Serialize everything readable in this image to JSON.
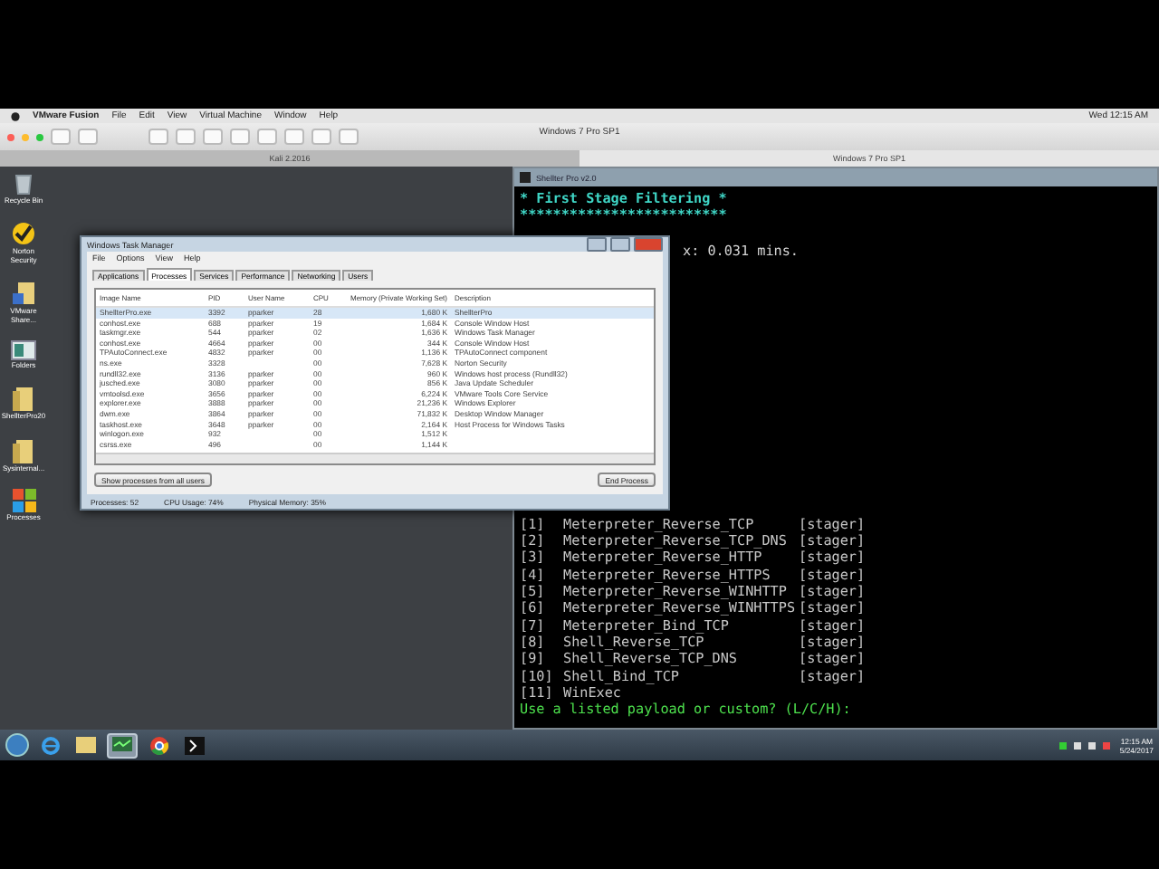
{
  "mac_menubar": {
    "app": "VMware Fusion",
    "menus": [
      "File",
      "Edit",
      "View",
      "Virtual Machine",
      "Window",
      "Help"
    ],
    "clock": "Wed 12:15 AM"
  },
  "vm_window": {
    "title": "Windows 7 Pro SP1",
    "tabs": [
      {
        "label": "Kali 2.2016",
        "selected": false
      },
      {
        "label": "Windows 7 Pro SP1",
        "selected": true
      }
    ]
  },
  "desktop_icons": [
    {
      "label": "Recycle Bin",
      "kind": "bin"
    },
    {
      "label": "Norton Security",
      "kind": "norton"
    },
    {
      "label": "VMware Share...",
      "kind": "share"
    },
    {
      "label": "Folders",
      "kind": "app"
    },
    {
      "label": "ShellterPro20",
      "kind": "folder"
    },
    {
      "label": "Sysinternal...",
      "kind": "folder"
    },
    {
      "label": "Processes",
      "kind": "windows"
    }
  ],
  "console": {
    "title": "Shellter Pro v2.0",
    "heading": "* First Stage Filtering *",
    "rule": "*************************",
    "elapsed": "x: 0.031 mins.",
    "payloads": [
      {
        "index": "[1]",
        "name": "Meterpreter_Reverse_TCP",
        "tag": "[stager]"
      },
      {
        "index": "[2]",
        "name": "Meterpreter_Reverse_TCP_DNS",
        "tag": "[stager]"
      },
      {
        "index": "[3]",
        "name": "Meterpreter_Reverse_HTTP",
        "tag": "[stager]"
      },
      {
        "index": "[4]",
        "name": "Meterpreter_Reverse_HTTPS",
        "tag": "[stager]"
      },
      {
        "index": "[5]",
        "name": "Meterpreter_Reverse_WINHTTP",
        "tag": "[stager]"
      },
      {
        "index": "[6]",
        "name": "Meterpreter_Reverse_WINHTTPS",
        "tag": "[stager]"
      },
      {
        "index": "[7]",
        "name": "Meterpreter_Bind_TCP",
        "tag": "[stager]"
      },
      {
        "index": "[8]",
        "name": "Shell_Reverse_TCP",
        "tag": "[stager]"
      },
      {
        "index": "[9]",
        "name": "Shell_Reverse_TCP_DNS",
        "tag": "[stager]"
      },
      {
        "index": "[10]",
        "name": "Shell_Bind_TCP",
        "tag": "[stager]"
      },
      {
        "index": "[11]",
        "name": "WinExec"
      }
    ],
    "prompt": "Use a listed payload or custom? (L/C/H):"
  },
  "task_manager": {
    "title": "Windows Task Manager",
    "menus": [
      "File",
      "Options",
      "View",
      "Help"
    ],
    "tabs": [
      {
        "label": "Applications",
        "selected": false
      },
      {
        "label": "Processes",
        "selected": true
      },
      {
        "label": "Services",
        "selected": false
      },
      {
        "label": "Performance",
        "selected": false
      },
      {
        "label": "Networking",
        "selected": false
      },
      {
        "label": "Users",
        "selected": false
      }
    ],
    "columns": [
      "Image Name",
      "PID",
      "User Name",
      "CPU",
      "Memory (Private Working Set)",
      "Description"
    ],
    "rows": [
      {
        "cells": [
          "ShellterPro.exe",
          "3392",
          "pparker",
          "28",
          "1,680 K",
          "ShellterPro"
        ],
        "selected": true
      },
      {
        "cells": [
          "conhost.exe",
          "688",
          "pparker",
          "19",
          "1,684 K",
          "Console Window Host"
        ],
        "selected": false
      },
      {
        "cells": [
          "taskmgr.exe",
          "544",
          "pparker",
          "02",
          "1,636 K",
          "Windows Task Manager"
        ],
        "selected": false
      },
      {
        "cells": [
          "conhost.exe",
          "4664",
          "pparker",
          "00",
          "344 K",
          "Console Window Host"
        ],
        "selected": false
      },
      {
        "cells": [
          "TPAutoConnect.exe",
          "4832",
          "pparker",
          "00",
          "1,136 K",
          "TPAutoConnect component"
        ],
        "selected": false
      },
      {
        "cells": [
          "ns.exe",
          "3328",
          "",
          "00",
          "7,628 K",
          "Norton Security"
        ],
        "selected": false
      },
      {
        "cells": [
          "rundll32.exe",
          "3136",
          "pparker",
          "00",
          "960 K",
          "Windows host process (Rundll32)"
        ],
        "selected": false
      },
      {
        "cells": [
          "jusched.exe",
          "3080",
          "pparker",
          "00",
          "856 K",
          "Java Update Scheduler"
        ],
        "selected": false
      },
      {
        "cells": [
          "vmtoolsd.exe",
          "3656",
          "pparker",
          "00",
          "6,224 K",
          "VMware Tools Core Service"
        ],
        "selected": false
      },
      {
        "cells": [
          "explorer.exe",
          "3888",
          "pparker",
          "00",
          "21,236 K",
          "Windows Explorer"
        ],
        "selected": false
      },
      {
        "cells": [
          "dwm.exe",
          "3864",
          "pparker",
          "00",
          "71,832 K",
          "Desktop Window Manager"
        ],
        "selected": false
      },
      {
        "cells": [
          "taskhost.exe",
          "3648",
          "pparker",
          "00",
          "2,164 K",
          "Host Process for Windows Tasks"
        ],
        "selected": false
      },
      {
        "cells": [
          "winlogon.exe",
          "932",
          "",
          "00",
          "1,512 K",
          ""
        ],
        "selected": false
      },
      {
        "cells": [
          "csrss.exe",
          "496",
          "",
          "00",
          "1,144 K",
          ""
        ],
        "selected": false
      }
    ],
    "show_all_button": "Show processes from all users",
    "end_button": "End Process",
    "status": [
      "Processes: 52",
      "CPU Usage: 74%",
      "Physical Memory: 35%"
    ]
  },
  "taskbar": {
    "apps": [
      {
        "kind": "ie",
        "active": false
      },
      {
        "kind": "explorer",
        "active": false
      },
      {
        "kind": "taskmgr",
        "active": true
      },
      {
        "kind": "chrome",
        "active": false
      },
      {
        "kind": "console",
        "active": false
      }
    ],
    "time": "12:15 AM",
    "date": "5/24/2017"
  }
}
